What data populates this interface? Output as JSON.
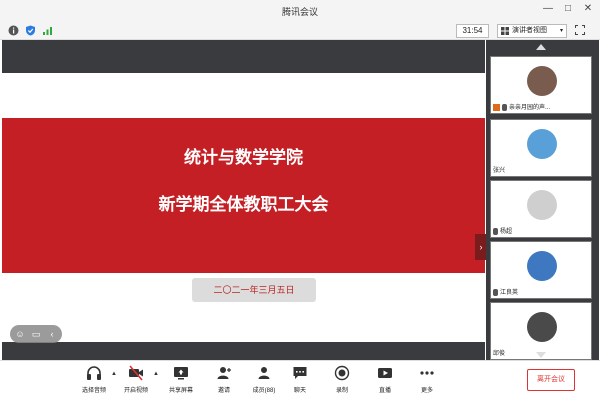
{
  "window": {
    "title": "腾讯会议",
    "controls": [
      "—",
      "□",
      "✕"
    ]
  },
  "status": {
    "timer": "31:54",
    "view_label": "演讲者视图"
  },
  "slide": {
    "title_line1": "统计与数学学院",
    "title_line2": "新学期全体教职工大会",
    "date": "二〇二一年三月五日"
  },
  "participants": [
    {
      "name": "亲亲月园的声...",
      "avatar_color": "#7a5c4f"
    },
    {
      "name": "张兴",
      "avatar_color": "#5aa0d8"
    },
    {
      "name": "杨超",
      "avatar_color": "#cfcfcf"
    },
    {
      "name": "江良英",
      "avatar_color": "#3d78c0"
    },
    {
      "name": "邱俊",
      "avatar_color": "#4a4a4a"
    }
  ],
  "toolbar": {
    "audio": "选择音频",
    "video": "开启视频",
    "share": "共享屏幕",
    "invite": "邀请",
    "members": "成员(88)",
    "chat": "聊天",
    "record": "录制",
    "live": "直播",
    "more": "更多",
    "end": "离开会议"
  },
  "colors": {
    "slide_red": "#c41f25",
    "dark_band": "#3a3b3e",
    "end_red": "#dd3333",
    "signal_green": "#2eaa3c",
    "shield_blue": "#2b7be0"
  }
}
